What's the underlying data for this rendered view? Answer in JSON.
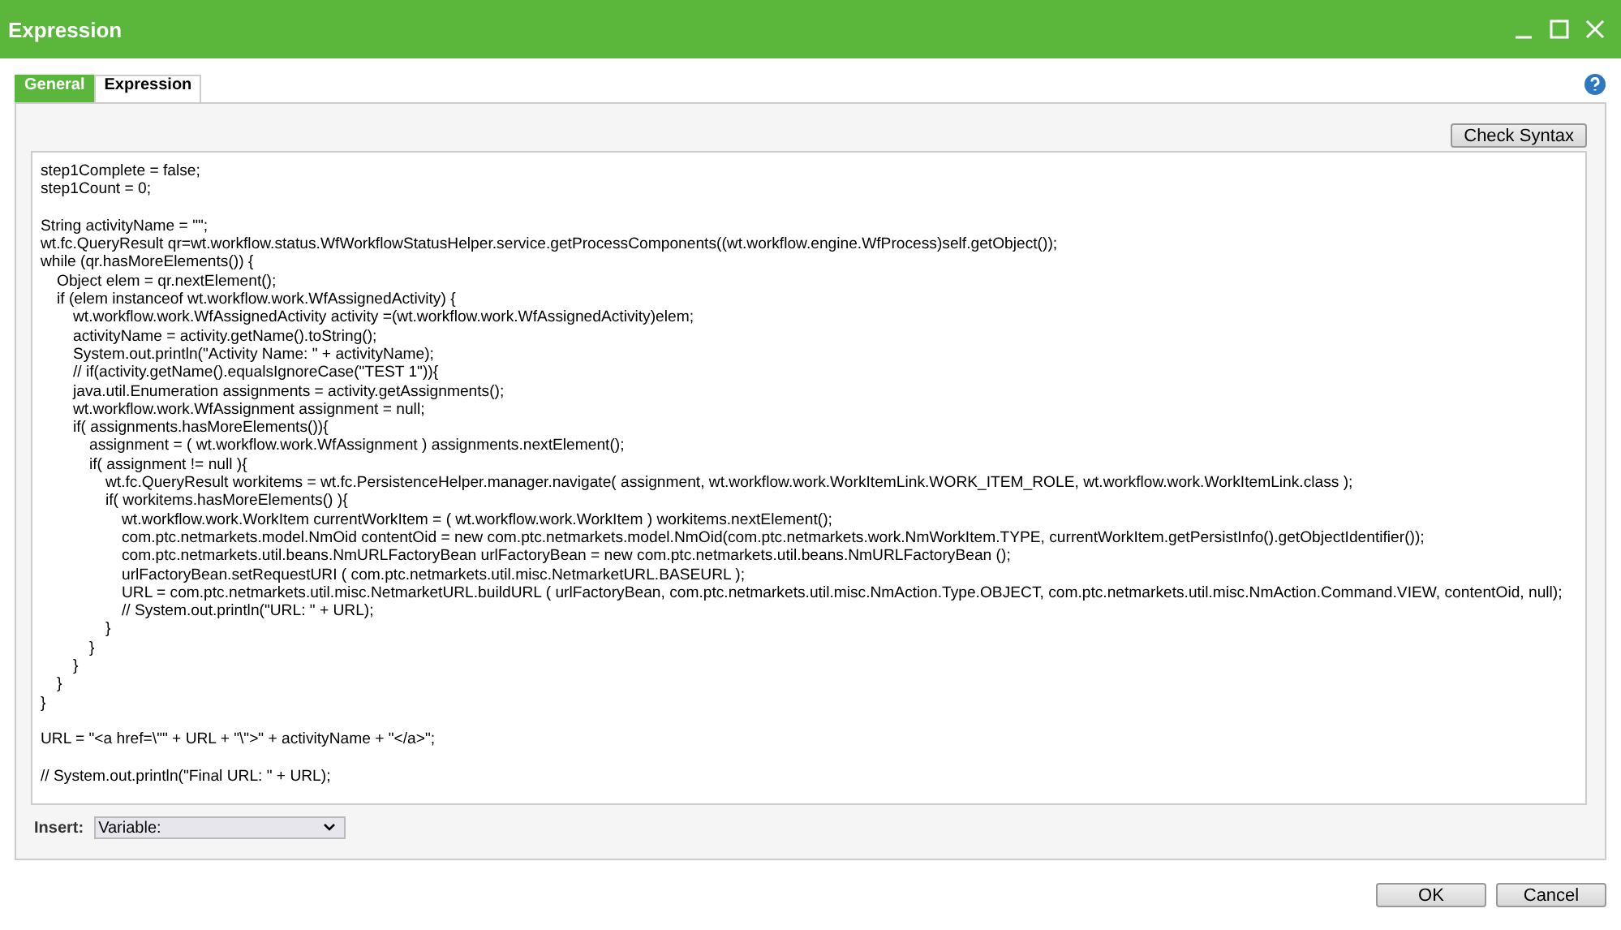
{
  "window": {
    "title": "Expression"
  },
  "tabs": [
    {
      "label": "General",
      "selected": false
    },
    {
      "label": "Expression",
      "selected": true
    }
  ],
  "toolbar": {
    "button": "Check Syntax"
  },
  "editor": {
    "value": "step1Complete = false;\nstep1Count = 0;\n\nString activityName = \"\";\nwt.fc.QueryResult qr=wt.workflow.status.WfWorkflowStatusHelper.service.getProcessComponents((wt.workflow.engine.WfProcess)self.getObject());\nwhile (qr.hasMoreElements()) {\n\tObject elem = qr.nextElement();\n\tif (elem instanceof wt.workflow.work.WfAssignedActivity) {\n\t\twt.workflow.work.WfAssignedActivity activity =(wt.workflow.work.WfAssignedActivity)elem;\n\t\tactivityName = activity.getName().toString();\n\t\tSystem.out.println(\"Activity Name: \" + activityName);\n\t\t// if(activity.getName().equalsIgnoreCase(\"TEST 1\")){\n\t\tjava.util.Enumeration assignments = activity.getAssignments();\n\t\twt.workflow.work.WfAssignment assignment = null;\n\t\tif( assignments.hasMoreElements()){\n\t\t\tassignment = ( wt.workflow.work.WfAssignment ) assignments.nextElement();\n\t\t\tif( assignment != null ){\n\t\t\t\twt.fc.QueryResult workitems = wt.fc.PersistenceHelper.manager.navigate( assignment, wt.workflow.work.WorkItemLink.WORK_ITEM_ROLE, wt.workflow.work.WorkItemLink.class );\n\t\t\t\tif( workitems.hasMoreElements() ){\n\t\t\t\t\twt.workflow.work.WorkItem currentWorkItem = ( wt.workflow.work.WorkItem ) workitems.nextElement();\n\t\t\t\t\tcom.ptc.netmarkets.model.NmOid contentOid = new com.ptc.netmarkets.model.NmOid(com.ptc.netmarkets.work.NmWorkItem.TYPE, currentWorkItem.getPersistInfo().getObjectIdentifier());\n\t\t\t\t\tcom.ptc.netmarkets.util.beans.NmURLFactoryBean urlFactoryBean = new com.ptc.netmarkets.util.beans.NmURLFactoryBean ();\n\t\t\t\t\turlFactoryBean.setRequestURI ( com.ptc.netmarkets.util.misc.NetmarketURL.BASEURL );\n\t\t\t\t\tURL = com.ptc.netmarkets.util.misc.NetmarketURL.buildURL ( urlFactoryBean, com.ptc.netmarkets.util.misc.NmAction.Type.OBJECT, com.ptc.netmarkets.util.misc.NmAction.Command.VIEW, contentOid, null);\n\t\t\t\t\t// System.out.println(\"URL: \" + URL);\n\t\t\t\t}\n\t\t\t}\n\t\t}\n\t}\n}\n\nURL = \"<a href=\\\"\" + URL + \"\\\">\" + activityName + \"</a>\";\n\n// System.out.println(\"Final URL: \" + URL);"
  },
  "insert": {
    "label": "Insert:",
    "value": "Variable:"
  },
  "buttons": [
    "OK",
    "Cancel"
  ]
}
